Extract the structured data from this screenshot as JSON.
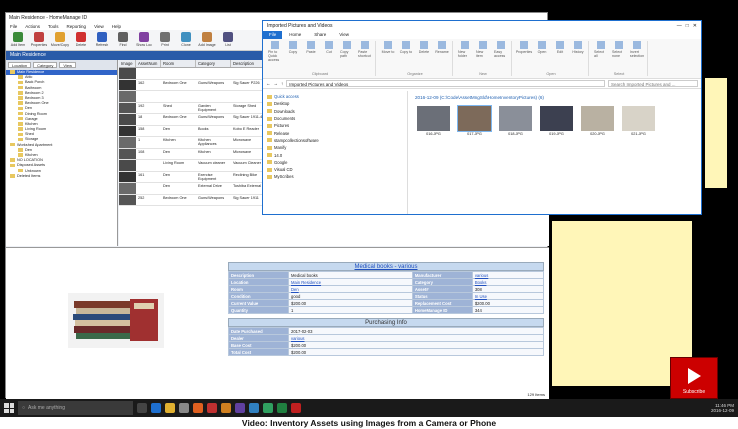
{
  "app": {
    "title": "Main Residence - HomeManage ID",
    "menu": [
      "File",
      "Actions",
      "Tools",
      "Reporting",
      "View",
      "Help"
    ],
    "toolbar": [
      "Add Item",
      "Properties",
      "Move/Copy",
      "Delete",
      "Refresh",
      "Find",
      "Show Loc",
      "Print",
      "Clone",
      "Add Image",
      "List"
    ],
    "location_bar": "Main Residence",
    "tree_tabs": [
      "Location",
      "Category",
      "View"
    ],
    "tree": [
      "Main Residence",
      "Attic",
      "Back Porch",
      "Bathroom",
      "Bedroom 2",
      "Bedroom 3",
      "Bedroom One",
      "Den",
      "Dining Room",
      "Garage",
      "Kitchen",
      "Living Room",
      "Shed",
      "Storage",
      "Workshed Apartment",
      "Den",
      "Kitchen",
      "NO LOCATION",
      "Disposed Assets",
      "Unknown",
      "Deleted Items"
    ],
    "grid_headers": [
      "Image",
      "AssetNum",
      "Room",
      "Category",
      "Description"
    ],
    "grid_rows": [
      [
        "",
        "",
        "",
        ""
      ],
      [
        "162",
        "Bedroom One",
        "Guns/Weapons",
        "Sig Sauer P226"
      ],
      [
        "",
        "",
        "",
        ""
      ],
      [
        "192",
        "Shed",
        "Garden Equipment",
        "Storage Shed"
      ],
      [
        "18",
        "Bedroom One",
        "Guns/Weapons",
        "Sig Sauer 1911-45 Cal"
      ],
      [
        "158",
        "Den",
        "Books",
        "Kobo E Reader"
      ],
      [
        "1",
        "Kitchen",
        "Kitchen Appliances",
        "Microwave"
      ],
      [
        "108",
        "Den",
        "Kitchen",
        "Microwave"
      ],
      [
        "",
        "Living Room",
        "Vacuum cleaner",
        "Vacuum Cleaner"
      ],
      [
        "161",
        "Den",
        "Exercise Equipment",
        "Reclining Bike"
      ],
      [
        "",
        "Den",
        "External Drive",
        "Toshiba External"
      ],
      [
        "252",
        "Bedroom One",
        "Guns/Weapons",
        "Sig Sauer 1911"
      ]
    ],
    "detail": {
      "title": "Medical books - various",
      "rows": [
        [
          "Description",
          "Medical books",
          "Manufacturer",
          "various"
        ],
        [
          "Location",
          "Main Residence",
          "Category",
          "Books"
        ],
        [
          "Room",
          "Den",
          "Asset#",
          "308"
        ],
        [
          "Condition",
          "good",
          "Status",
          "In Use"
        ],
        [
          "Current Value",
          "$200.00",
          "Replacement Cost",
          "$200.00"
        ],
        [
          "Quantity",
          "1",
          "HomeManage ID",
          "344"
        ]
      ],
      "purchasing_title": "Purchasing Info",
      "purchasing_rows": [
        [
          "Date Purchased",
          "2017-02-03"
        ],
        [
          "Dealer",
          "various"
        ],
        [
          "Base Cost",
          "$200.00"
        ],
        [
          "Total Cost",
          "$200.00"
        ]
      ]
    },
    "status": "129 Items"
  },
  "explorer": {
    "title": "Imported Pictures and Videos",
    "tabs": [
      "File",
      "Home",
      "Share",
      "View"
    ],
    "ribbon_groups": [
      {
        "name": "Clipboard",
        "items": [
          "Pin to Quick access",
          "Copy",
          "Paste",
          "Cut",
          "Copy path",
          "Paste shortcut"
        ]
      },
      {
        "name": "Organize",
        "items": [
          "Move to",
          "Copy to",
          "Delete",
          "Rename"
        ]
      },
      {
        "name": "New",
        "items": [
          "New folder",
          "New item",
          "Easy access"
        ]
      },
      {
        "name": "Open",
        "items": [
          "Properties",
          "Open",
          "Edit",
          "History"
        ]
      },
      {
        "name": "Select",
        "items": [
          "Select all",
          "Select none",
          "Invert selection"
        ]
      }
    ],
    "address": "Imported Pictures and Videos",
    "search_placeholder": "Search Imported Pictures and ...",
    "nav": [
      "Quick access",
      "Desktop",
      "Downloads",
      "Documents",
      "Pictures",
      "Release",
      "stampcollectionsoftware",
      "Manify",
      "14.0",
      "Google",
      "Visual CD",
      "MyScribes"
    ],
    "folder_header": "2016-12-09 (C:\\Code\\AssetMngSld\\HomeInventoryPictures) (6)",
    "files": [
      "016.JPG",
      "017.JPG",
      "018.JPG",
      "019.JPG",
      "020.JPG",
      "021.JPG"
    ],
    "tile_colors": [
      "#6b6f78",
      "#7d6a5a",
      "#8a8f99",
      "#3c4050",
      "#b9b1a2",
      "#d8d3c8"
    ]
  },
  "taskbar": {
    "search_placeholder": "Ask me anything",
    "time": "11:46 PM",
    "date": "2016-12-09"
  },
  "subscribe": "Subscribe",
  "caption": "Video: Inventory Assets using Images from a Camera or Phone"
}
